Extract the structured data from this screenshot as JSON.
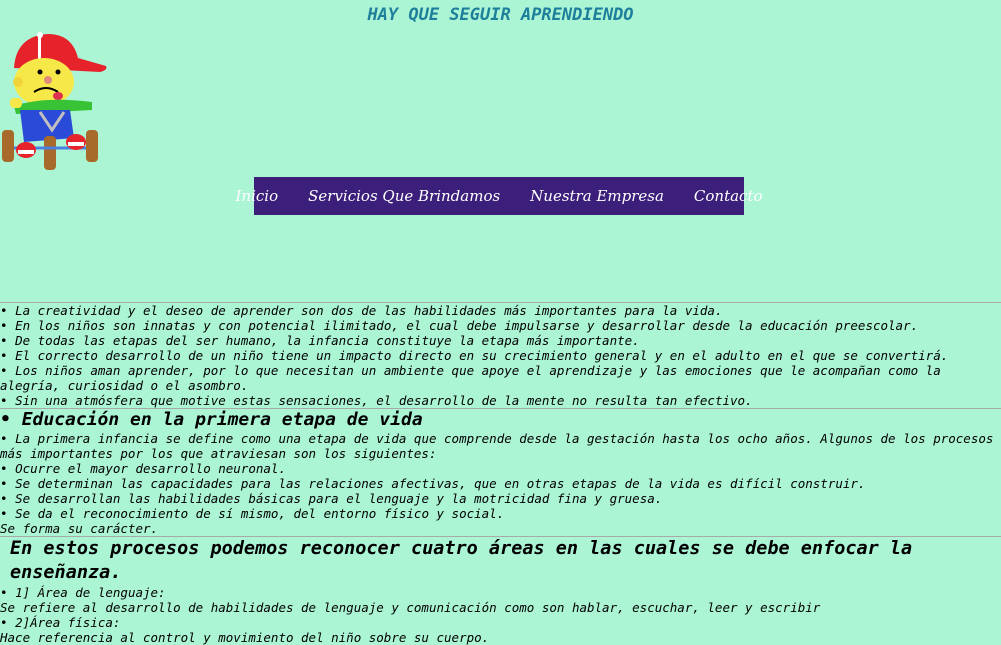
{
  "page": {
    "title": "HAY QUE SEGUIR APRENDIENDO"
  },
  "logo": {
    "icon": "kid-on-tricycle-icon"
  },
  "nav": {
    "items": [
      {
        "label": "Inicio"
      },
      {
        "label": "Servicios Que Brindamos"
      },
      {
        "label": "Nuestra Empresa"
      },
      {
        "label": "Contacto"
      }
    ]
  },
  "section1": {
    "bullets": [
      "La creatividad y el deseo de aprender son dos de las habilidades más importantes para la vida.",
      "En los niños son innatas y con potencial ilimitado, el cual debe impulsarse y desarrollar desde la educación preescolar.",
      "De todas las etapas del ser humano, la infancia constituye la etapa más importante.",
      "El correcto desarrollo de un niño tiene un impacto directo en su crecimiento general y en el adulto en el que se convertirá.",
      "Los niños aman aprender, por lo que necesitan un ambiente que apoye el aprendizaje y las emociones que le acompañan como la alegría, curiosidad o el asombro.",
      "Sin una atmósfera que motive estas sensaciones, el desarrollo de la mente no resulta tan efectivo."
    ]
  },
  "section2": {
    "heading": "Educación en la primera etapa de vida",
    "intro": "La primera infancia se define como una etapa de vida que comprende desde la gestación hasta los ocho años. Algunos de los procesos más importantes por los que atraviesan son los siguientes:",
    "bullets": [
      "Ocurre el mayor desarrollo neuronal.",
      "Se determinan las capacidades para las relaciones afectivas, que en otras etapas de la vida es difícil construir.",
      "Se desarrollan las habilidades básicas para el lenguaje y la motricidad fina y gruesa.",
      "Se da el reconocimiento de sí mismo, del entorno físico y social."
    ],
    "closing": "Se forma su carácter."
  },
  "section3": {
    "heading": "En estos procesos podemos reconocer cuatro áreas en las cuales se debe enfocar la enseñanza.",
    "area1_title": "1] Área de lenguaje:",
    "area1_desc": "Se refiere al desarrollo de habilidades de lenguaje y comunicación como son hablar, escuchar, leer y escribir",
    "area2_title": "2]Área física:",
    "area2_desc": "Hace referencia al control y movimiento del niño sobre su cuerpo."
  }
}
